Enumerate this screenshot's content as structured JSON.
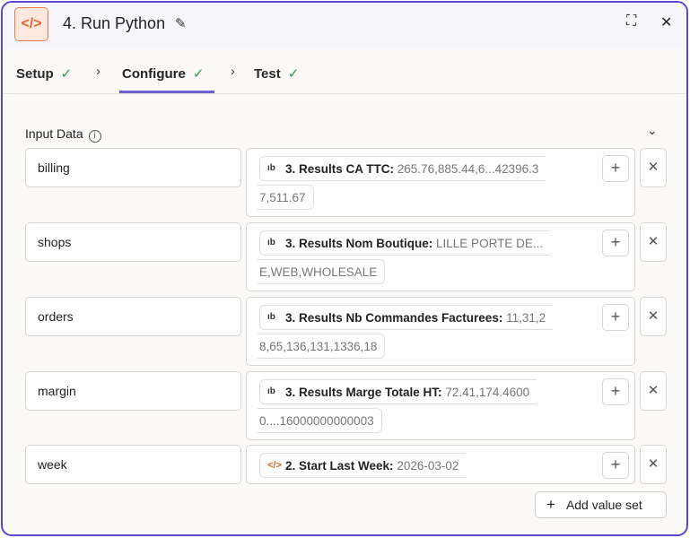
{
  "header": {
    "title": "4. Run Python"
  },
  "tabs": [
    {
      "label": "Setup"
    },
    {
      "label": "Configure"
    },
    {
      "label": "Test"
    }
  ],
  "section": {
    "label": "Input Data"
  },
  "rows": [
    {
      "key": "billing",
      "step": "3. Results CA TTC:",
      "value": "265.76,885.44,6...42396.3",
      "value_cont": "7,511.67",
      "icon": "formatter-icon"
    },
    {
      "key": "shops",
      "step": "3. Results Nom Boutique:",
      "value": "LILLE PORTE DE...",
      "value_cont": "E,WEB,WHOLESALE",
      "icon": "formatter-icon"
    },
    {
      "key": "orders",
      "step": "3. Results Nb Commandes Facturees:",
      "value": "11,31,2",
      "value_cont": "8,65,136,131,1336,18",
      "icon": "formatter-icon"
    },
    {
      "key": "margin",
      "step": "3. Results Marge Totale HT:",
      "value": "72.41,174.4600",
      "value_cont": "0....16000000000003",
      "icon": "formatter-icon"
    },
    {
      "key": "week",
      "step": "2. Start Last Week:",
      "value": "2026-03-02",
      "icon": "code-icon"
    }
  ],
  "add_button": "Add value set"
}
